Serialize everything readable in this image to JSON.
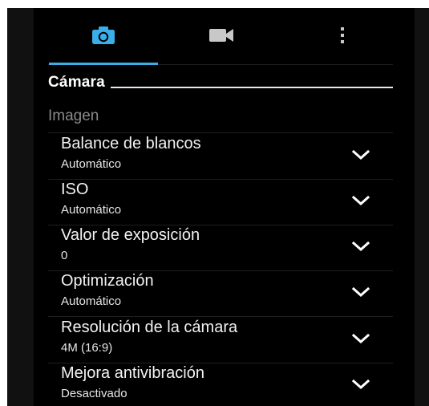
{
  "tabs": [
    {
      "icon": "camera-icon",
      "selected": true
    },
    {
      "icon": "video-camera-icon",
      "selected": false
    },
    {
      "icon": "more-vert-icon",
      "selected": false
    }
  ],
  "colors": {
    "accent": "#3aaee8",
    "inactive_icon": "#c8c8c8",
    "background": "#000000"
  },
  "section": {
    "title": "Cámara",
    "subheader": "Imagen"
  },
  "settings": [
    {
      "label": "Balance de blancos",
      "value": "Automático",
      "icon": "chevron-down-icon"
    },
    {
      "label": "ISO",
      "value": "Automático",
      "icon": "chevron-down-icon"
    },
    {
      "label": "Valor de exposición",
      "value": "0",
      "icon": "chevron-down-icon"
    },
    {
      "label": "Optimización",
      "value": "Automático",
      "icon": "chevron-down-icon"
    },
    {
      "label": "Resolución de la cámara",
      "value": "4M (16:9)",
      "icon": "chevron-down-icon"
    },
    {
      "label": "Mejora antivibración",
      "value": "Desactivado",
      "icon": "chevron-down-icon"
    }
  ]
}
